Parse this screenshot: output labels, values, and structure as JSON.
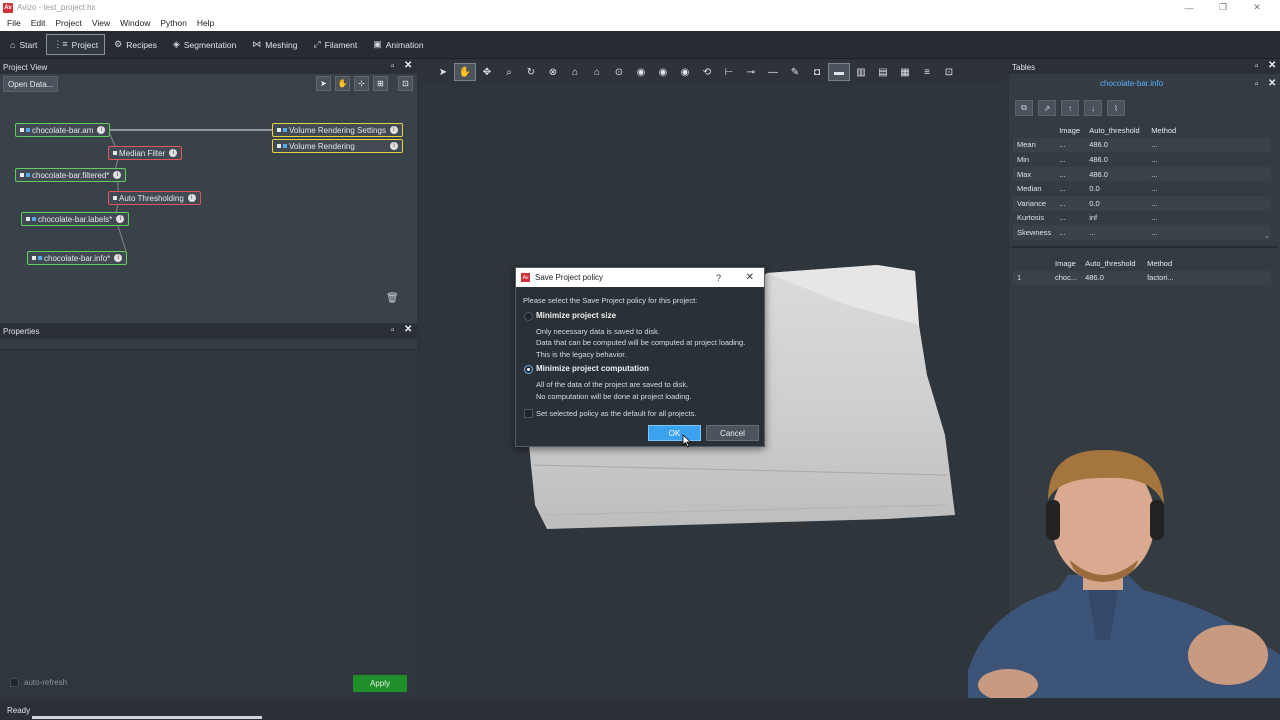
{
  "window": {
    "title": "Avizo - test_project.hx",
    "controls": [
      "—",
      "❐",
      "✕"
    ]
  },
  "menu": [
    "File",
    "Edit",
    "Project",
    "View",
    "Window",
    "Python",
    "Help"
  ],
  "workrooms": [
    {
      "label": "Start",
      "icon": "home-icon",
      "glyph": "⌂"
    },
    {
      "label": "Project",
      "icon": "project-icon",
      "glyph": "⋮≡",
      "active": true
    },
    {
      "label": "Recipes",
      "icon": "recipes-icon",
      "glyph": "⚙"
    },
    {
      "label": "Segmentation",
      "icon": "segmentation-icon",
      "glyph": "◈"
    },
    {
      "label": "Meshing",
      "icon": "meshing-icon",
      "glyph": "⋈"
    },
    {
      "label": "Filament",
      "icon": "filament-icon",
      "glyph": "⤢"
    },
    {
      "label": "Animation",
      "icon": "animation-icon",
      "glyph": "▣"
    }
  ],
  "project_view": {
    "title": "Project View",
    "open_data": "Open Data...",
    "nodes": [
      {
        "label": "chocolate-bar.am",
        "color": "green"
      },
      {
        "label": "Median Filter",
        "color": "red"
      },
      {
        "label": "chocolate-bar.filtered*",
        "color": "green"
      },
      {
        "label": "Auto Thresholding",
        "color": "red"
      },
      {
        "label": "chocolate-bar.labels*",
        "color": "green"
      },
      {
        "label": "chocolate-bar.info*",
        "color": "green"
      },
      {
        "label": "Volume Rendering Settings",
        "color": "yellow"
      },
      {
        "label": "Volume Rendering",
        "color": "yellow"
      }
    ]
  },
  "properties": {
    "title": "Properties",
    "auto_refresh": "auto-refresh",
    "apply": "Apply"
  },
  "tables": {
    "title": "Tables",
    "file": "chocolate-bar.info",
    "table1": {
      "headers": [
        "",
        "Image",
        "Auto_threshold",
        "Method"
      ],
      "rows": [
        [
          "Mean",
          "...",
          "486.0",
          "..."
        ],
        [
          "Min",
          "...",
          "486.0",
          "..."
        ],
        [
          "Max",
          "...",
          "486.0",
          "..."
        ],
        [
          "Median",
          "...",
          "0.0",
          "..."
        ],
        [
          "Variance",
          "...",
          "0.0",
          "..."
        ],
        [
          "Kurtosis",
          "...",
          "inf",
          "..."
        ],
        [
          "Skewness",
          "...",
          "...",
          "..."
        ]
      ]
    },
    "table2": {
      "headers": [
        "",
        "Image",
        "Auto_threshold",
        "Method"
      ],
      "rows": [
        [
          "1",
          "choc...",
          "486.0",
          "factori..."
        ]
      ]
    }
  },
  "dialog": {
    "title": "Save Project policy",
    "help": "?",
    "close": "✕",
    "prompt": "Please select the Save Project policy for this project:",
    "option1_title": "Minimize project size",
    "option1_line1": "Only necessary data is saved to disk.",
    "option1_line2": "Data that can be computed will be computed at project loading.",
    "option1_line3": "This is the legacy behavior.",
    "option2_title": "Minimize project computation",
    "option2_line1": "All of the data of the project are saved to disk.",
    "option2_line2": "No computation will be done at project loading.",
    "default_checkbox": "Set selected policy as the default for all projects.",
    "ok": "OK",
    "cancel": "Cancel",
    "selected_option": 2
  },
  "status": {
    "text": "Ready"
  },
  "colors": {
    "accent_blue": "#3ba2f0",
    "node_green": "#5fcf5a",
    "node_red": "#e0555a",
    "node_yellow": "#e6d23e",
    "apply_green": "#1f8f2a",
    "link_blue": "#5cb0ff"
  }
}
